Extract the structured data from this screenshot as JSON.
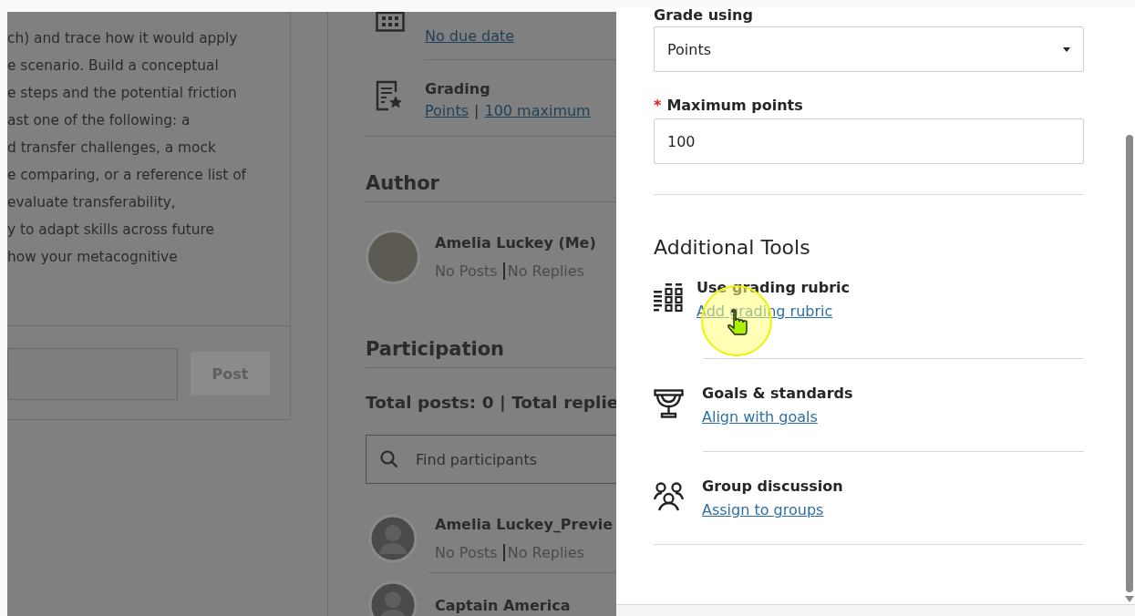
{
  "discussion_text": {
    "lines": [
      "ch) and trace how it would apply",
      "e scenario. Build a conceptual",
      "e steps and the potential friction",
      "ast one of the following: a",
      "d transfer challenges, a mock",
      "e comparing, or a reference list of",
      "evaluate transferability,",
      "y to adapt skills across future",
      "how your metacognitive"
    ],
    "post_button": "Post"
  },
  "details": {
    "due_date": {
      "link": "No due date"
    },
    "grading": {
      "label": "Grading",
      "links": [
        "Points",
        "100 maximum"
      ],
      "separator": "|"
    }
  },
  "author": {
    "heading": "Author",
    "person": {
      "name": "Amelia Luckey (Me)",
      "posts": "No Posts",
      "replies": "No Replies"
    }
  },
  "participation": {
    "heading": "Participation",
    "totals": "Total posts: 0 | Total replie",
    "search": {
      "placeholder": "Find participants"
    },
    "participants": [
      {
        "name": "Amelia Luckey_Previe",
        "posts": "No Posts",
        "replies": "No Replies"
      },
      {
        "name": "Captain America"
      }
    ]
  },
  "settings_panel": {
    "grade_using": {
      "label": "Grade using",
      "value": "Points"
    },
    "maximum_points": {
      "required_mark": "*",
      "label": "Maximum points",
      "value": "100"
    },
    "additional_tools": {
      "heading": "Additional Tools",
      "tools": [
        {
          "kind": "rubric",
          "title": "Use grading rubric",
          "link": "Add grading rubric"
        },
        {
          "kind": "goals",
          "title": "Goals & standards",
          "link": "Align with goals"
        },
        {
          "kind": "groups",
          "title": "Group discussion",
          "link": "Assign to groups"
        }
      ]
    }
  }
}
